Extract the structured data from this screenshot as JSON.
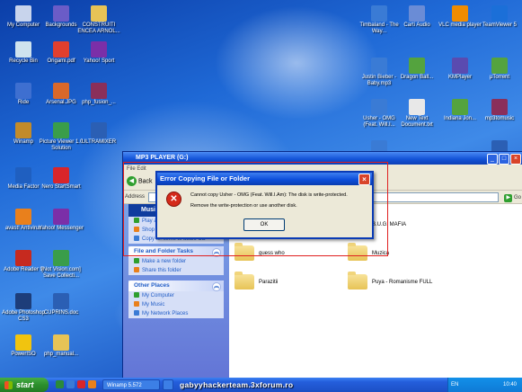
{
  "desktop_icons": [
    {
      "label": "My Computer",
      "icon": "my-computer-icon",
      "color": "#c8d4ec"
    },
    {
      "label": "Recycle Bin",
      "icon": "recycle-bin-icon",
      "color": "#cfe3ee"
    },
    {
      "label": "Ride",
      "icon": "ride-icon",
      "color": "#3e6fd0"
    },
    {
      "label": "Winamp",
      "icon": "winamp-icon",
      "color": "#c28b2a"
    },
    {
      "label": "Media Factor",
      "icon": "media-icon",
      "color": "#1f5fc0"
    },
    {
      "label": "avast! Antivirus",
      "icon": "avast-icon",
      "color": "#e9801c"
    },
    {
      "label": "Adobe Reader 9",
      "icon": "adobe-reader-icon",
      "color": "#c62a1f"
    },
    {
      "label": "Adobe Photoshop CS3",
      "icon": "photoshop-icon",
      "color": "#1d3d7a"
    },
    {
      "label": "PowerISO",
      "icon": "poweriso-icon",
      "color": "#f1c40f"
    },
    {
      "label": "Backgrounds",
      "icon": "folder-icon",
      "color": "#6a5cc7"
    },
    {
      "label": "Origami.pdf",
      "icon": "pdf-icon",
      "color": "#e13f2e"
    },
    {
      "label": "Arsenal.JPG",
      "icon": "image-icon",
      "color": "#d9682a"
    },
    {
      "label": "Picture Viewer 1.0 Solution",
      "icon": "picture-viewer-icon",
      "color": "#3a9d4a"
    },
    {
      "label": "Nero StartSmart",
      "icon": "nero-icon",
      "color": "#d9252a"
    },
    {
      "label": "Yahoo! Messenger",
      "icon": "yahoo-messenger-icon",
      "color": "#7b2fa8"
    },
    {
      "label": "[Not Vision.com] Save Collecti...",
      "icon": "app-icon",
      "color": "#3a9d4a"
    },
    {
      "label": "CUPRINS.doc",
      "icon": "word-doc-icon",
      "color": "#2b5fb4"
    },
    {
      "label": "php_manual...",
      "icon": "help-icon",
      "color": "#e7c356"
    },
    {
      "label": "CONSTRUITI ENCEA ARNOL...",
      "icon": "folder-icon",
      "color": "#e7c356"
    },
    {
      "label": "Yahoo! Sport",
      "icon": "yahoo-icon",
      "color": "#7b2fa8"
    },
    {
      "label": "php_fusion_...",
      "icon": "archive-icon",
      "color": "#8a2f5a"
    },
    {
      "label": "ULTRAMIXER",
      "icon": "word-doc-icon",
      "color": "#2b5fb4"
    },
    {
      "label": "Timbaland - The Way...",
      "icon": "mp3-icon",
      "color": "#3a7bd5"
    },
    {
      "label": "Justin Bieber - Baby.mp3",
      "icon": "mp3-icon",
      "color": "#3a7bd5"
    },
    {
      "label": "Usher - OMG (Feat. Will.I...",
      "icon": "mp3-icon",
      "color": "#3a7bd5"
    },
    {
      "label": "PlayMusic",
      "icon": "mp3-icon",
      "color": "#3a7bd5"
    },
    {
      "label": "Carti Audio",
      "icon": "audio-icon",
      "color": "#6a8cd6"
    },
    {
      "label": "Dragon Ball...",
      "icon": "utorrent-icon",
      "color": "#54a33e"
    },
    {
      "label": "New Text Document.txt",
      "icon": "text-doc-icon",
      "color": "#e8e8e8"
    },
    {
      "label": "VLC media player",
      "icon": "vlc-icon",
      "color": "#f08c00"
    },
    {
      "label": "KMPlayer",
      "icon": "kmplayer-icon",
      "color": "#5a4bb0"
    },
    {
      "label": "Indiana Jon...",
      "icon": "utorrent-icon",
      "color": "#54a33e"
    },
    {
      "label": "TeamViewer 5",
      "icon": "teamviewer-icon",
      "color": "#1b6fd8"
    },
    {
      "label": "µTorrent",
      "icon": "utorrent-icon",
      "color": "#54a33e"
    },
    {
      "label": "mp3tomusic",
      "icon": "archive-icon",
      "color": "#8a2f5a"
    },
    {
      "label": "Imprimanta",
      "icon": "word-doc-icon",
      "color": "#2b5fb4"
    }
  ],
  "explorer": {
    "title": "MP3 PLAYER (G:)",
    "menu": "File  Edit",
    "back_label": "Back",
    "address_label": "Address",
    "go_label": "Go",
    "music_tasks": {
      "title": "Music Tasks",
      "items": [
        "Play all",
        "Shop for music online",
        "Copy all items to audio CD"
      ]
    },
    "file_folder_tasks": {
      "title": "File and Folder Tasks",
      "items": [
        "Make a new folder",
        "Share this folder"
      ]
    },
    "other_places": {
      "title": "Other Places",
      "items": [
        "My Computer",
        "My Music",
        "My Network Places"
      ]
    },
    "files": [
      "B.U.G. MAFIA",
      "guess who",
      "Muzica",
      "Parazitii",
      "Puya - Romanisme  FULL"
    ]
  },
  "error_dialog": {
    "title": "Error Copying File or Folder",
    "message": "Cannot copy Usher - OMG (Feat. Will.I.Am): The disk is write-protected.",
    "detail": "Remove the write-protection or use another disk.",
    "ok_label": "OK",
    "close_glyph": "×",
    "icon_glyph": "✕"
  },
  "taskbar": {
    "start_label": "start",
    "tasks": [
      "Winamp 5.572",
      "MP3 PLAYER (G:)"
    ],
    "language": "EN",
    "clock": "10:40"
  },
  "watermark": "gabyyhackerteam.3xforum.ro",
  "colors": {
    "taskbar": "#245edc",
    "start": "#2c8f2c",
    "error_red": "#d42a1a"
  }
}
